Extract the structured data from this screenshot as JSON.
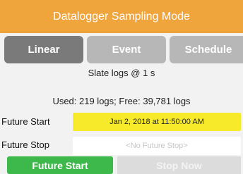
{
  "header": {
    "title": "Datalogger Sampling Mode"
  },
  "mode_tabs": [
    {
      "label": "Linear",
      "active": true
    },
    {
      "label": "Event",
      "active": false
    },
    {
      "label": "Schedule",
      "active": false
    }
  ],
  "status": {
    "rate": "Slate logs @ 1 s",
    "usage": "Used: 219 logs; Free: 39,781 logs"
  },
  "future_start": {
    "label": "Future Start",
    "value": "Jan 2, 2018 at 11:50:00 AM"
  },
  "future_stop": {
    "label": "Future Stop",
    "value": "<No Future Stop>"
  },
  "actions": {
    "start_label": "Future Start",
    "stop_label": "Stop Now"
  },
  "colors": {
    "header": "#f0a43c",
    "tab_active": "#7a7a7a",
    "tab_inactive": "#b7b7b7",
    "start_highlight": "#f6ea2a",
    "start_button": "#3db84a",
    "stop_button_disabled": "#dcdcdc"
  }
}
